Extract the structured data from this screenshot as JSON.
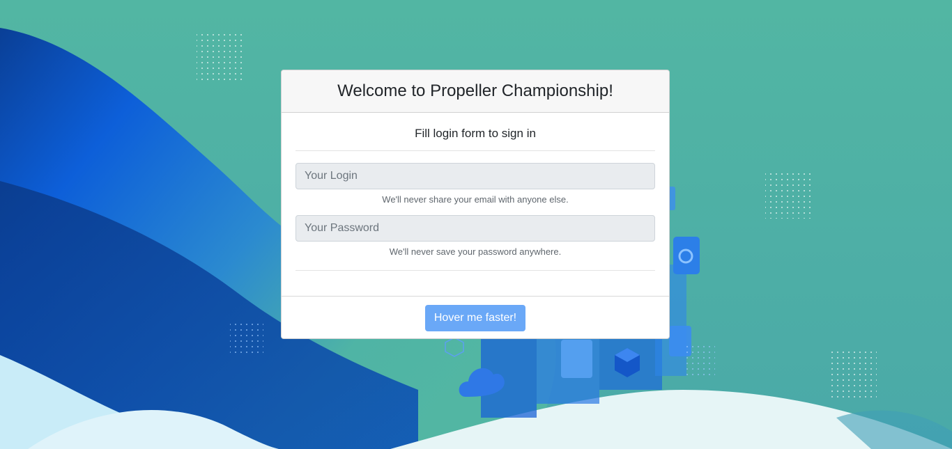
{
  "header": {
    "title": "Welcome to Propeller Championship!"
  },
  "form": {
    "subtitle": "Fill login form to sign in",
    "login": {
      "placeholder": "Your Login",
      "value": "",
      "help": "We'll never share your email with anyone else."
    },
    "password": {
      "placeholder": "Your Password",
      "value": "",
      "help": "We'll never save your password anywhere."
    }
  },
  "footer": {
    "button_label": "Hover me faster!"
  },
  "colors": {
    "background_top": "#52b6a3",
    "background_blue": "#0d5fd9",
    "background_navy": "#063a8a",
    "button": "#6aa8f7",
    "card_header": "#f7f7f7"
  },
  "icons": [
    "cloud-icon",
    "cube-icon",
    "server-stack-icon",
    "dot-grid-icon"
  ]
}
